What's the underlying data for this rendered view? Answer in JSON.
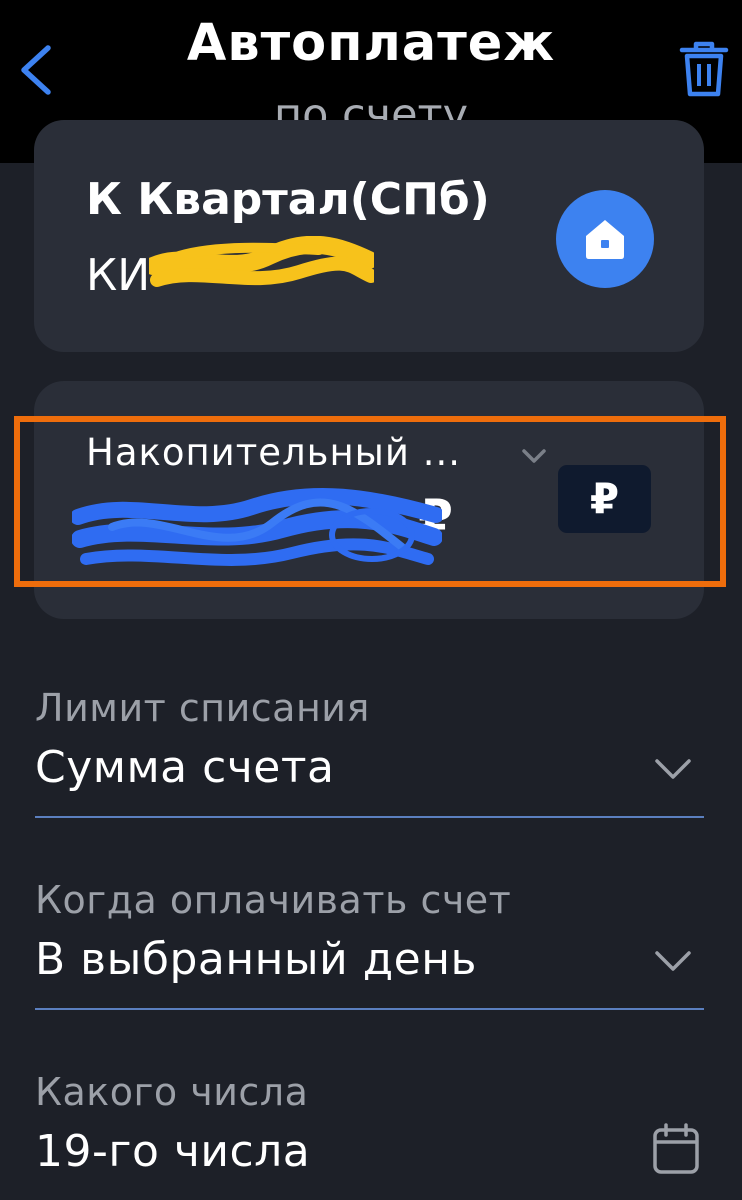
{
  "header": {
    "title": "Автоплатеж",
    "subtitle": "по счету",
    "back_icon": "chevron-left-icon",
    "delete_icon": "trash-icon"
  },
  "payee": {
    "title": "К Квартал(СПб)",
    "subtitle_prefix": "КИ",
    "icon": "house-icon"
  },
  "source_account": {
    "name": "Накопительный ...",
    "currency_symbol": "₽",
    "badge_symbol": "₽"
  },
  "limit": {
    "label": "Лимит списания",
    "value": "Сумма счета"
  },
  "schedule": {
    "label": "Когда оплачивать счет",
    "value": "В выбранный день"
  },
  "day": {
    "label": "Какого числа",
    "value": "19-го числа",
    "icon": "calendar-icon"
  },
  "colors": {
    "background": "#1d2028",
    "card": "#2a2e38",
    "accent_blue": "#3d82f0",
    "highlight_orange": "#ee6d0c",
    "underline": "#5b7fbf"
  }
}
